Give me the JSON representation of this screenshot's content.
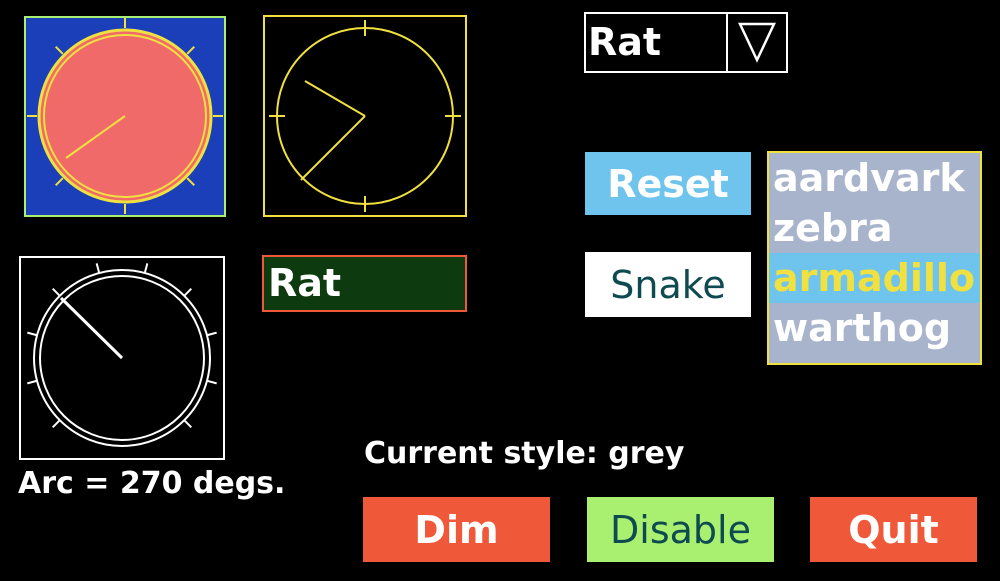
{
  "colors": {
    "background": "#000000",
    "dial_blue_bg": "#1a3fb8",
    "dial_red_fill": "#f06a6a",
    "yellow": "#f0e040",
    "green": "#aaf070",
    "reset_bg": "#6ec4ec",
    "list_bg": "#a8b4cc",
    "list_selected_bg": "#6ec4ec",
    "red_button": "#f0583a",
    "textbox_bg": "#0e3a10"
  },
  "dials": {
    "filled": {
      "value_angle_deg": 235
    },
    "clock": {
      "hour_angle_deg": 300,
      "minute_angle_deg": 225
    },
    "arc": {
      "pointer_angle_deg": 315,
      "arc_label": "Arc = 270 degs."
    }
  },
  "textbox": {
    "value": "Rat"
  },
  "dropdown": {
    "selected": "Rat",
    "arrow_icon": "triangle-down-icon"
  },
  "buttons": {
    "reset": "Reset",
    "snake": "Snake",
    "dim": "Dim",
    "disable": "Disable",
    "quit": "Quit"
  },
  "listbox": {
    "items": [
      "aardvark",
      "zebra",
      "armadillo",
      "warthog"
    ],
    "selected_index": 2
  },
  "status": {
    "current_style": "Current style: grey"
  }
}
